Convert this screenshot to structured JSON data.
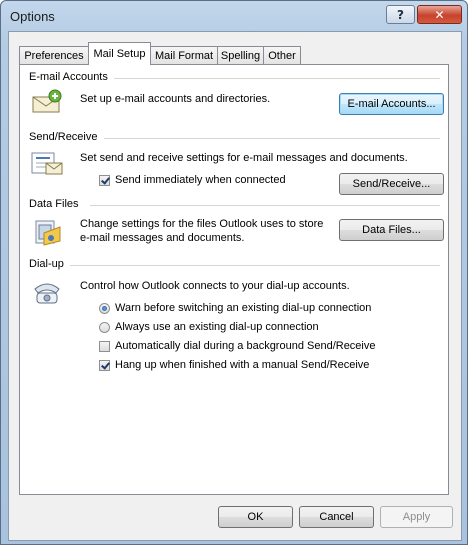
{
  "window": {
    "title": "Options"
  },
  "tabs": [
    {
      "label": "Preferences"
    },
    {
      "label": "Mail Setup"
    },
    {
      "label": "Mail Format"
    },
    {
      "label": "Spelling"
    },
    {
      "label": "Other"
    }
  ],
  "active_tab": "Mail Setup",
  "sections": {
    "email_accounts": {
      "header": "E-mail Accounts",
      "description": "Set up e-mail accounts and directories.",
      "button": "E-mail Accounts..."
    },
    "send_receive": {
      "header": "Send/Receive",
      "description": "Set send and receive settings for e-mail messages and documents.",
      "checkbox_label": "Send immediately when connected",
      "checkbox_checked": true,
      "button": "Send/Receive..."
    },
    "data_files": {
      "header": "Data Files",
      "description_line1": "Change settings for the files Outlook uses to store",
      "description_line2": "e-mail messages and documents.",
      "button": "Data Files..."
    },
    "dialup": {
      "header": "Dial-up",
      "description": "Control how Outlook connects to your dial-up accounts.",
      "options": [
        {
          "type": "radio",
          "label": "Warn before switching an existing dial-up connection",
          "checked": true
        },
        {
          "type": "radio",
          "label": "Always use an existing dial-up connection",
          "checked": false
        },
        {
          "type": "checkbox",
          "label": "Automatically dial during a background Send/Receive",
          "checked": false
        },
        {
          "type": "checkbox",
          "label": "Hang up when finished with a manual Send/Receive",
          "checked": true
        }
      ]
    }
  },
  "footer": {
    "ok": "OK",
    "cancel": "Cancel",
    "apply": "Apply"
  },
  "icons": {
    "email_accounts": "mail-accounts-icon",
    "send_receive": "send-receive-icon",
    "data_files": "data-files-icon",
    "dialup": "telephone-icon"
  },
  "colors": {
    "accent": "#3c7fb1",
    "close": "#c7432d"
  }
}
